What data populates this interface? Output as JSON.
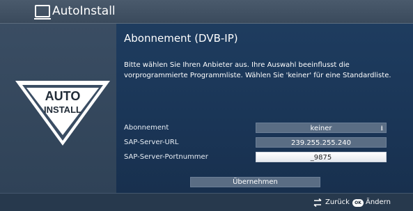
{
  "window": {
    "title": "AutoInstall"
  },
  "logo": {
    "line1": "AUTO",
    "line2": "INSTALL"
  },
  "main": {
    "heading": "Abonnement (DVB-IP)",
    "description": "Bitte wählen Sie Ihren Anbieter aus. Ihre Auswahl beeinflusst die vorprogrammierte Programmliste. Wählen Sie 'keiner' für eine Standardliste."
  },
  "settings": {
    "subscription": {
      "label": "Abonnement",
      "value": "keiner"
    },
    "server_url": {
      "label": "SAP-Server-URL",
      "value": "239.255.255.240"
    },
    "server_port": {
      "label": "SAP-Server-Portnummer",
      "value": "_9875"
    }
  },
  "apply_button": {
    "label": "Übernehmen"
  },
  "footer": {
    "back_label": "Zurück",
    "ok_badge": "OK",
    "change_label": "Ändern"
  }
}
